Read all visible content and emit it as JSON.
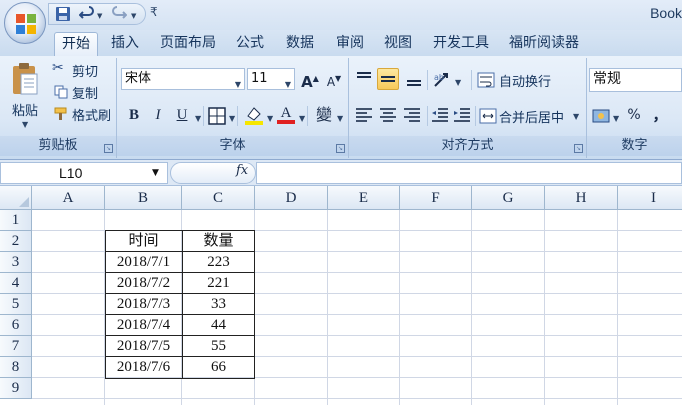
{
  "window": {
    "title": "Book"
  },
  "quick_access": {
    "more_label": "₹"
  },
  "tabs": [
    "开始",
    "插入",
    "页面布局",
    "公式",
    "数据",
    "审阅",
    "视图",
    "开发工具",
    "福昕阅读器"
  ],
  "clipboard": {
    "paste": "粘贴",
    "cut": "剪切",
    "copy": "复制",
    "format_painter": "格式刷",
    "group": "剪贴板"
  },
  "font": {
    "name": "宋体",
    "size": "11",
    "bold": "B",
    "italic": "I",
    "underline": "U",
    "font_color": "A",
    "phonetic": "變",
    "grow": "A",
    "shrink": "A",
    "group": "字体"
  },
  "alignment": {
    "wrap": "自动换行",
    "merge": "合并后居中",
    "group": "对齐方式"
  },
  "number": {
    "format": "常规",
    "percent": "%",
    "comma": "，",
    "group": "数字"
  },
  "formula_bar": {
    "name_box": "L10",
    "fx": "fx",
    "value": ""
  },
  "grid": {
    "columns": [
      "A",
      "B",
      "C",
      "D",
      "E",
      "F",
      "G",
      "H",
      "I"
    ],
    "rows": [
      "1",
      "2",
      "3",
      "4",
      "5",
      "6",
      "7",
      "8",
      "9"
    ],
    "table": {
      "headers": [
        "时间",
        "数量"
      ],
      "rows": [
        [
          "2018/7/1",
          "223"
        ],
        [
          "2018/7/2",
          "221"
        ],
        [
          "2018/7/3",
          "33"
        ],
        [
          "2018/7/4",
          "44"
        ],
        [
          "2018/7/5",
          "55"
        ],
        [
          "2018/7/6",
          "66"
        ]
      ]
    }
  },
  "colors": {
    "ribbon": "#dce8f6",
    "tab_active": "#ffffff",
    "highlight_yellow": "#f8c95a",
    "font_red": "#e02020"
  }
}
